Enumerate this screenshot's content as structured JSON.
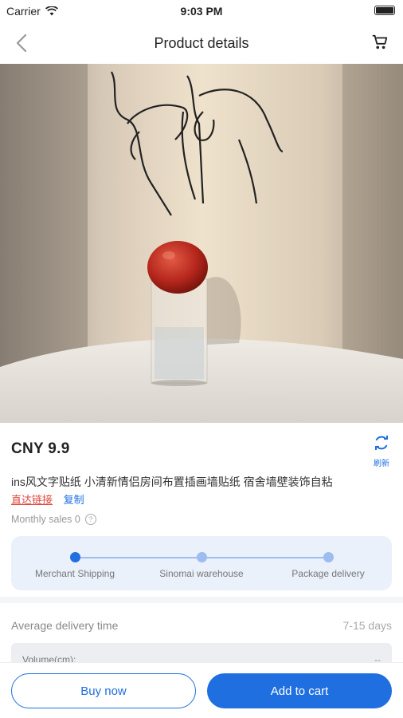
{
  "status": {
    "carrier": "Carrier",
    "time": "9:03 PM"
  },
  "nav": {
    "title": "Product details"
  },
  "product": {
    "price": "CNY 9.9",
    "refresh_label": "刷新",
    "title": "ins风文字贴纸 小清新情侣房间布置插画墙贴纸 宿舍墙壁装饰自粘",
    "direct_link": "直达链接",
    "copy": "复制",
    "monthly_sales": "Monthly sales 0"
  },
  "steps": [
    "Merchant Shipping",
    "Sinomai warehouse",
    "Package delivery"
  ],
  "delivery": {
    "label": "Average delivery time",
    "value": "7-15 days",
    "volume_label": "Volume(cm):",
    "volume_value": "--"
  },
  "actions": {
    "buy_now": "Buy now",
    "add_to_cart": "Add to cart"
  },
  "colors": {
    "accent": "#1f6fe0",
    "link_red": "#e0483e"
  }
}
